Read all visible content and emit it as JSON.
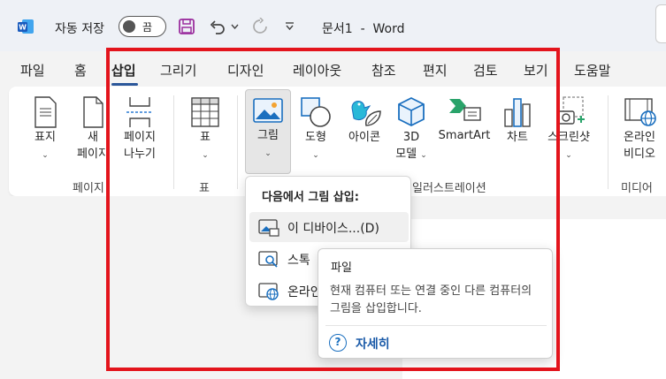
{
  "titlebar": {
    "app_icon": "word-logo-icon",
    "autosave_label": "자동 저장",
    "autosave_state": "끔",
    "doc_title": "문서1  -  Word"
  },
  "tabs": [
    "파일",
    "홈",
    "삽입",
    "그리기",
    "디자인",
    "레이아웃",
    "참조",
    "편지",
    "검토",
    "보기",
    "도움말"
  ],
  "active_tab": "삽입",
  "ribbon": {
    "cover": "표지",
    "new_page": [
      "새",
      "페이지"
    ],
    "page_break": [
      "페이지",
      "나누기"
    ],
    "table": "표",
    "picture": "그림",
    "shapes": "도형",
    "icons": "아이콘",
    "model3d": [
      "3D",
      "모델"
    ],
    "smartart": "SmartArt",
    "chart": "차트",
    "screenshot": "스크린샷",
    "online_video": [
      "온라인",
      "비디오"
    ],
    "groups": {
      "pages": "페이지",
      "tables": "표",
      "illustrations": "일러스트레이션",
      "media": "미디어"
    }
  },
  "dropdown": {
    "header": "다음에서 그림 삽입:",
    "items": [
      "이 디바이스...(D)",
      "스톡",
      "온라인"
    ]
  },
  "tooltip": {
    "title": "파일",
    "desc": "현재 컴퓨터 또는 연결 중인 다른 컴퓨터의 그림을 삽입합니다.",
    "help": "자세히"
  },
  "colors": {
    "accent": "#2b579a",
    "highlight_frame": "#e3141c",
    "link": "#1a5aa8"
  }
}
